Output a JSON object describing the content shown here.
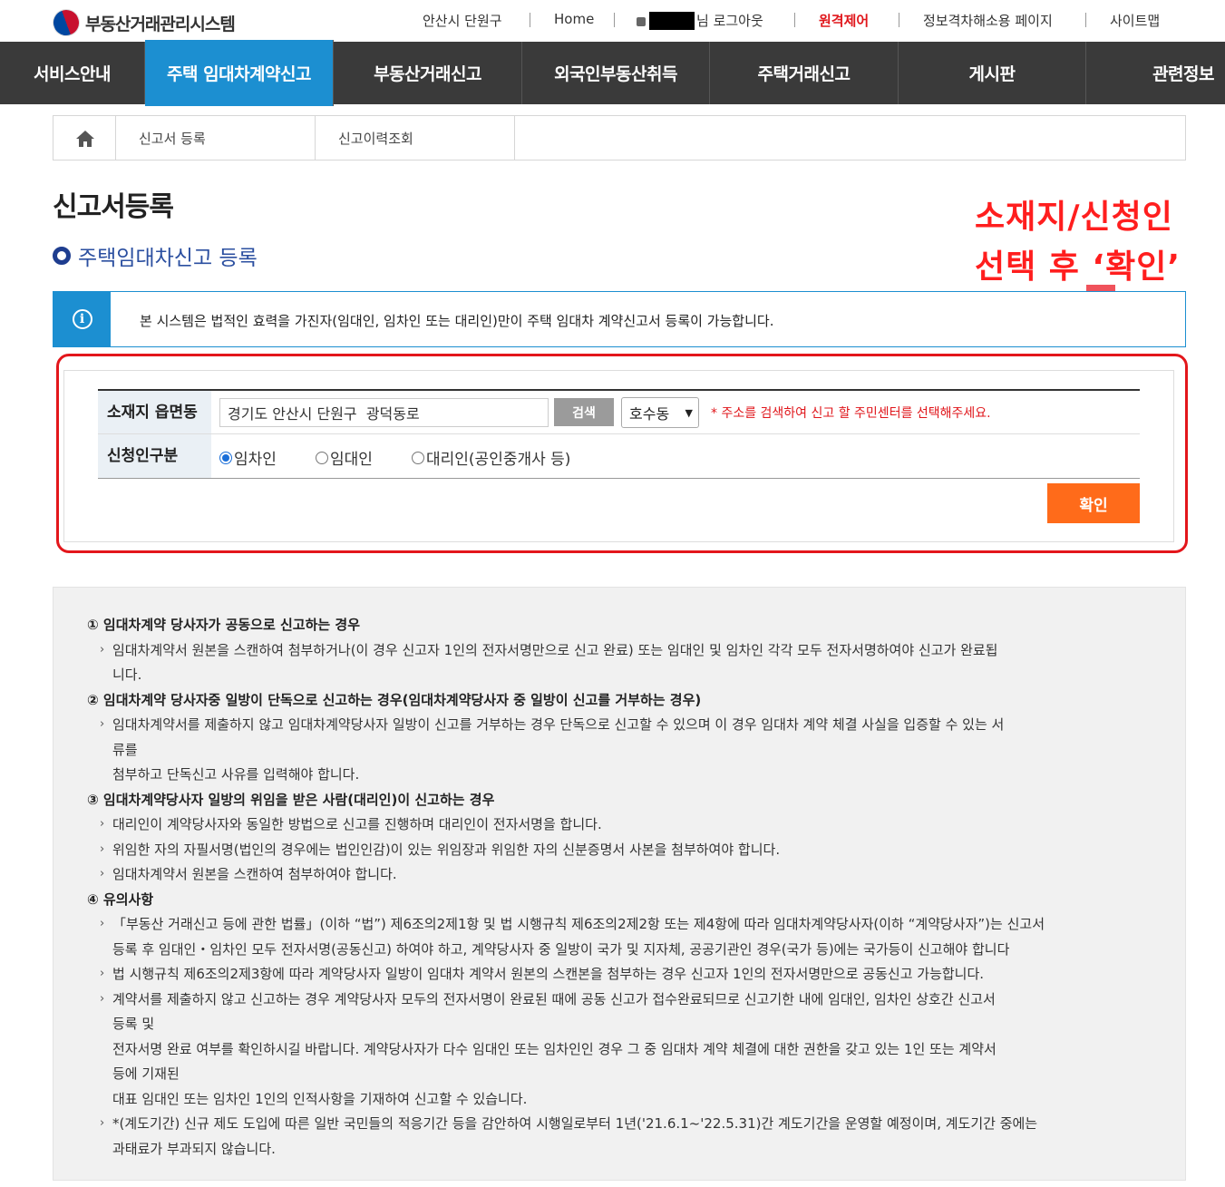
{
  "header": {
    "logo_text": "부동산거래관리시스템",
    "office": "안산시 단원구",
    "home": "Home",
    "user_suffix": "님 로그아웃",
    "remote": "원격제어",
    "accessibility": "정보격차해소용 페이지",
    "sitemap": "사이트맵"
  },
  "nav": {
    "items": [
      "서비스안내",
      "주택 임대차계약신고",
      "부동산거래신고",
      "외국인부동산취득",
      "주택거래신고",
      "게시판",
      "관련정보"
    ],
    "active_index": 1
  },
  "breadcrumb": {
    "items": [
      "신고서 등록",
      "신고이력조회"
    ]
  },
  "page": {
    "title": "신고서등록",
    "subtitle": "주택임대차신고 등록"
  },
  "annotation": {
    "line1": "소재지/신청인",
    "line2": "선택 후 ‘확인’",
    "color": "#ff1e1e"
  },
  "notice": {
    "icon": "info-icon",
    "text": "본 시스템은 법적인 효력을 가진자(임대인, 임차인 또는 대리인)만이 주택 임대차 계약신고서 등록이 가능합니다."
  },
  "form": {
    "location_label": "소재지 읍면동",
    "address_value": "경기도 안산시 단원구  광덕동로",
    "search_label": "검색",
    "dong_selected": "호수동",
    "hint": "* 주소를 검색하여 신고 할 주민센터를 선택해주세요.",
    "applicant_label": "신청인구분",
    "applicant_options": [
      "임차인",
      "임대인",
      "대리인(공인중개사 등)"
    ],
    "applicant_selected": "임차인",
    "confirm_label": "확인"
  },
  "guide": {
    "s1_title": "① 임대차계약 당사자가 공동으로 신고하는 경우",
    "s1_p1a": "임대차계약서 원본을 스캔하여 첨부하거나(이 경우 신고자 1인의 전자서명만으로 신고 완료) 또는 임대인 및 임차인 각각 모두 전자서명하여야 신고가 완료됩",
    "s1_p1b": "니다.",
    "s2_title": "② 임대차계약 당사자중 일방이 단독으로 신고하는 경우(임대차계약당사자 중 일방이 신고를 거부하는 경우)",
    "s2_p1a": "임대차계약서를 제출하지 않고 임대차계약당사자 일방이 신고를 거부하는 경우 단독으로 신고할 수 있으며 이 경우 임대차 계약 체결 사실을 입증할 수 있는 서",
    "s2_p1b": "류를",
    "s2_p1c": "첨부하고 단독신고 사유를 입력해야 합니다.",
    "s3_title": "③ 임대차계약당사자 일방의 위임을 받은 사람(대리인)이 신고하는 경우",
    "s3_p1": "대리인이 계약당사자와 동일한 방법으로 신고를 진행하며 대리인이 전자서명을 합니다.",
    "s3_p2": "위임한 자의 자필서명(법인의 경우에는 법인인감)이 있는 위임장과 위임한 자의 신분증명서 사본을 첨부하여야 합니다.",
    "s3_p3": "임대차계약서 원본을 스캔하여 첨부하여야 합니다.",
    "s4_title": "④ 유의사항",
    "s4_p1a": "「부동산 거래신고 등에 관한 법률」(이하 “법”) 제6조의2제1항 및 법 시행규칙 제6조의2제2항 또는 제4항에 따라 임대차계약당사자(이하 “계약당사자”)는 신고서",
    "s4_p1b": "등록 후 임대인・임차인 모두 전자서명(공동신고) 하여야 하고, 계약당사자 중 일방이 국가 및 지자체, 공공기관인 경우(국가 등)에는 국가등이 신고해야 합니다",
    "s4_p2": "법 시행규칙 제6조의2제3항에 따라 계약당사자 일방이 임대차 계약서 원본의 스캔본을 첨부하는 경우 신고자 1인의 전자서명만으로 공동신고 가능합니다.",
    "s4_p3a": "계약서를 제출하지 않고 신고하는 경우 계약당사자 모두의 전자서명이 완료된 때에 공동 신고가 접수완료되므로 신고기한 내에 임대인, 임차인 상호간 신고서",
    "s4_p3b": "등록 및",
    "s4_p3c": "전자서명 완료 여부를 확인하시길 바랍니다. 계약당사자가 다수 임대인 또는 임차인인 경우 그 중 임대차 계약 체결에 대한 권한을 갖고 있는 1인 또는 계약서",
    "s4_p3d": "등에 기재된",
    "s4_p3e": "대표 임대인 또는 임차인 1인의 인적사항을 기재하여 신고할 수 있습니다.",
    "s4_p4a": "*(계도기간) 신규 제도 도입에 따른 일반 국민들의 적응기간 등을 감안하여 시행일로부터 1년('21.6.1~'22.5.31)간 계도기간을 운영할 예정이며, 계도기간 중에는",
    "s4_p4b": "과태료가 부과되지 않습니다."
  }
}
